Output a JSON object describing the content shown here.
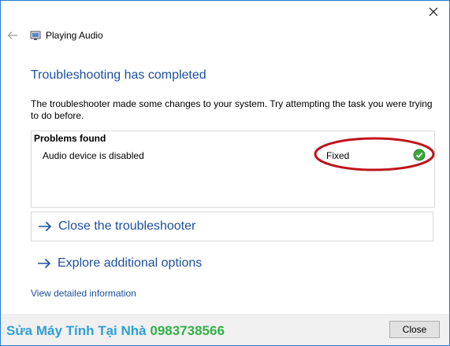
{
  "window": {
    "app_title": "Playing Audio",
    "close_icon": "close-icon",
    "back_icon": "back-arrow-icon"
  },
  "main": {
    "heading": "Troubleshooting has completed",
    "description": "The troubleshooter made some changes to your system. Try attempting the task you were trying to do before.",
    "problems": {
      "header": "Problems found",
      "items": [
        {
          "label": "Audio device is disabled",
          "status": "Fixed",
          "status_icon": "check-icon"
        }
      ]
    },
    "commands": [
      {
        "label": "Close the troubleshooter",
        "icon": "arrow-right-icon"
      },
      {
        "label": "Explore additional options",
        "icon": "arrow-right-icon"
      }
    ],
    "details_link": "View detailed information"
  },
  "footer": {
    "watermark_name": "Sửa Máy Tính Tại Nhà",
    "watermark_phone": "0983738566",
    "close_button": "Close"
  },
  "colors": {
    "accent": "#1c4f9c",
    "highlight_ellipse": "#c0141c",
    "fixed_check": "#3aa63a",
    "watermark_text": "#2ea0d6",
    "watermark_phone": "#33b04a"
  }
}
